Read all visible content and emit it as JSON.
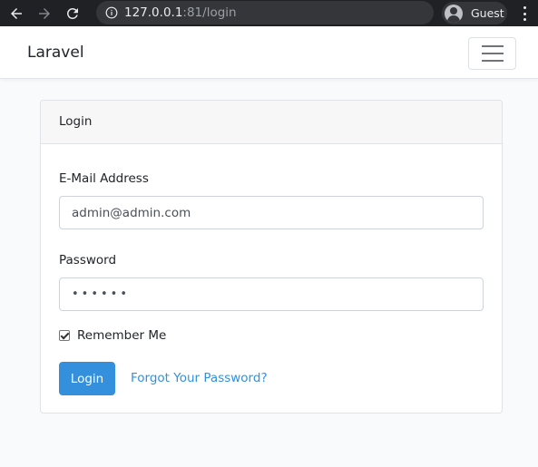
{
  "browser": {
    "url_host": "127.0.0.1",
    "url_rest": ":81/login",
    "profile_label": "Guest",
    "icons": {
      "back": "arrow-left-icon",
      "forward": "arrow-right-icon",
      "reload": "reload-icon",
      "info": "info-icon",
      "profile": "person-icon",
      "menu": "kebab-menu-icon"
    }
  },
  "navbar": {
    "brand": "Laravel",
    "toggler_icon": "hamburger-icon"
  },
  "login_card": {
    "title": "Login",
    "email": {
      "label": "E-Mail Address",
      "value": "admin@admin.com"
    },
    "password": {
      "label": "Password",
      "masked_value": "••••••"
    },
    "remember": {
      "label": "Remember Me",
      "checked": true
    },
    "login_button": "Login",
    "forgot_link": "Forgot Your Password?"
  },
  "colors": {
    "primary": "#3490dc",
    "page_background": "#f8fafc",
    "chrome_background": "#202124"
  }
}
